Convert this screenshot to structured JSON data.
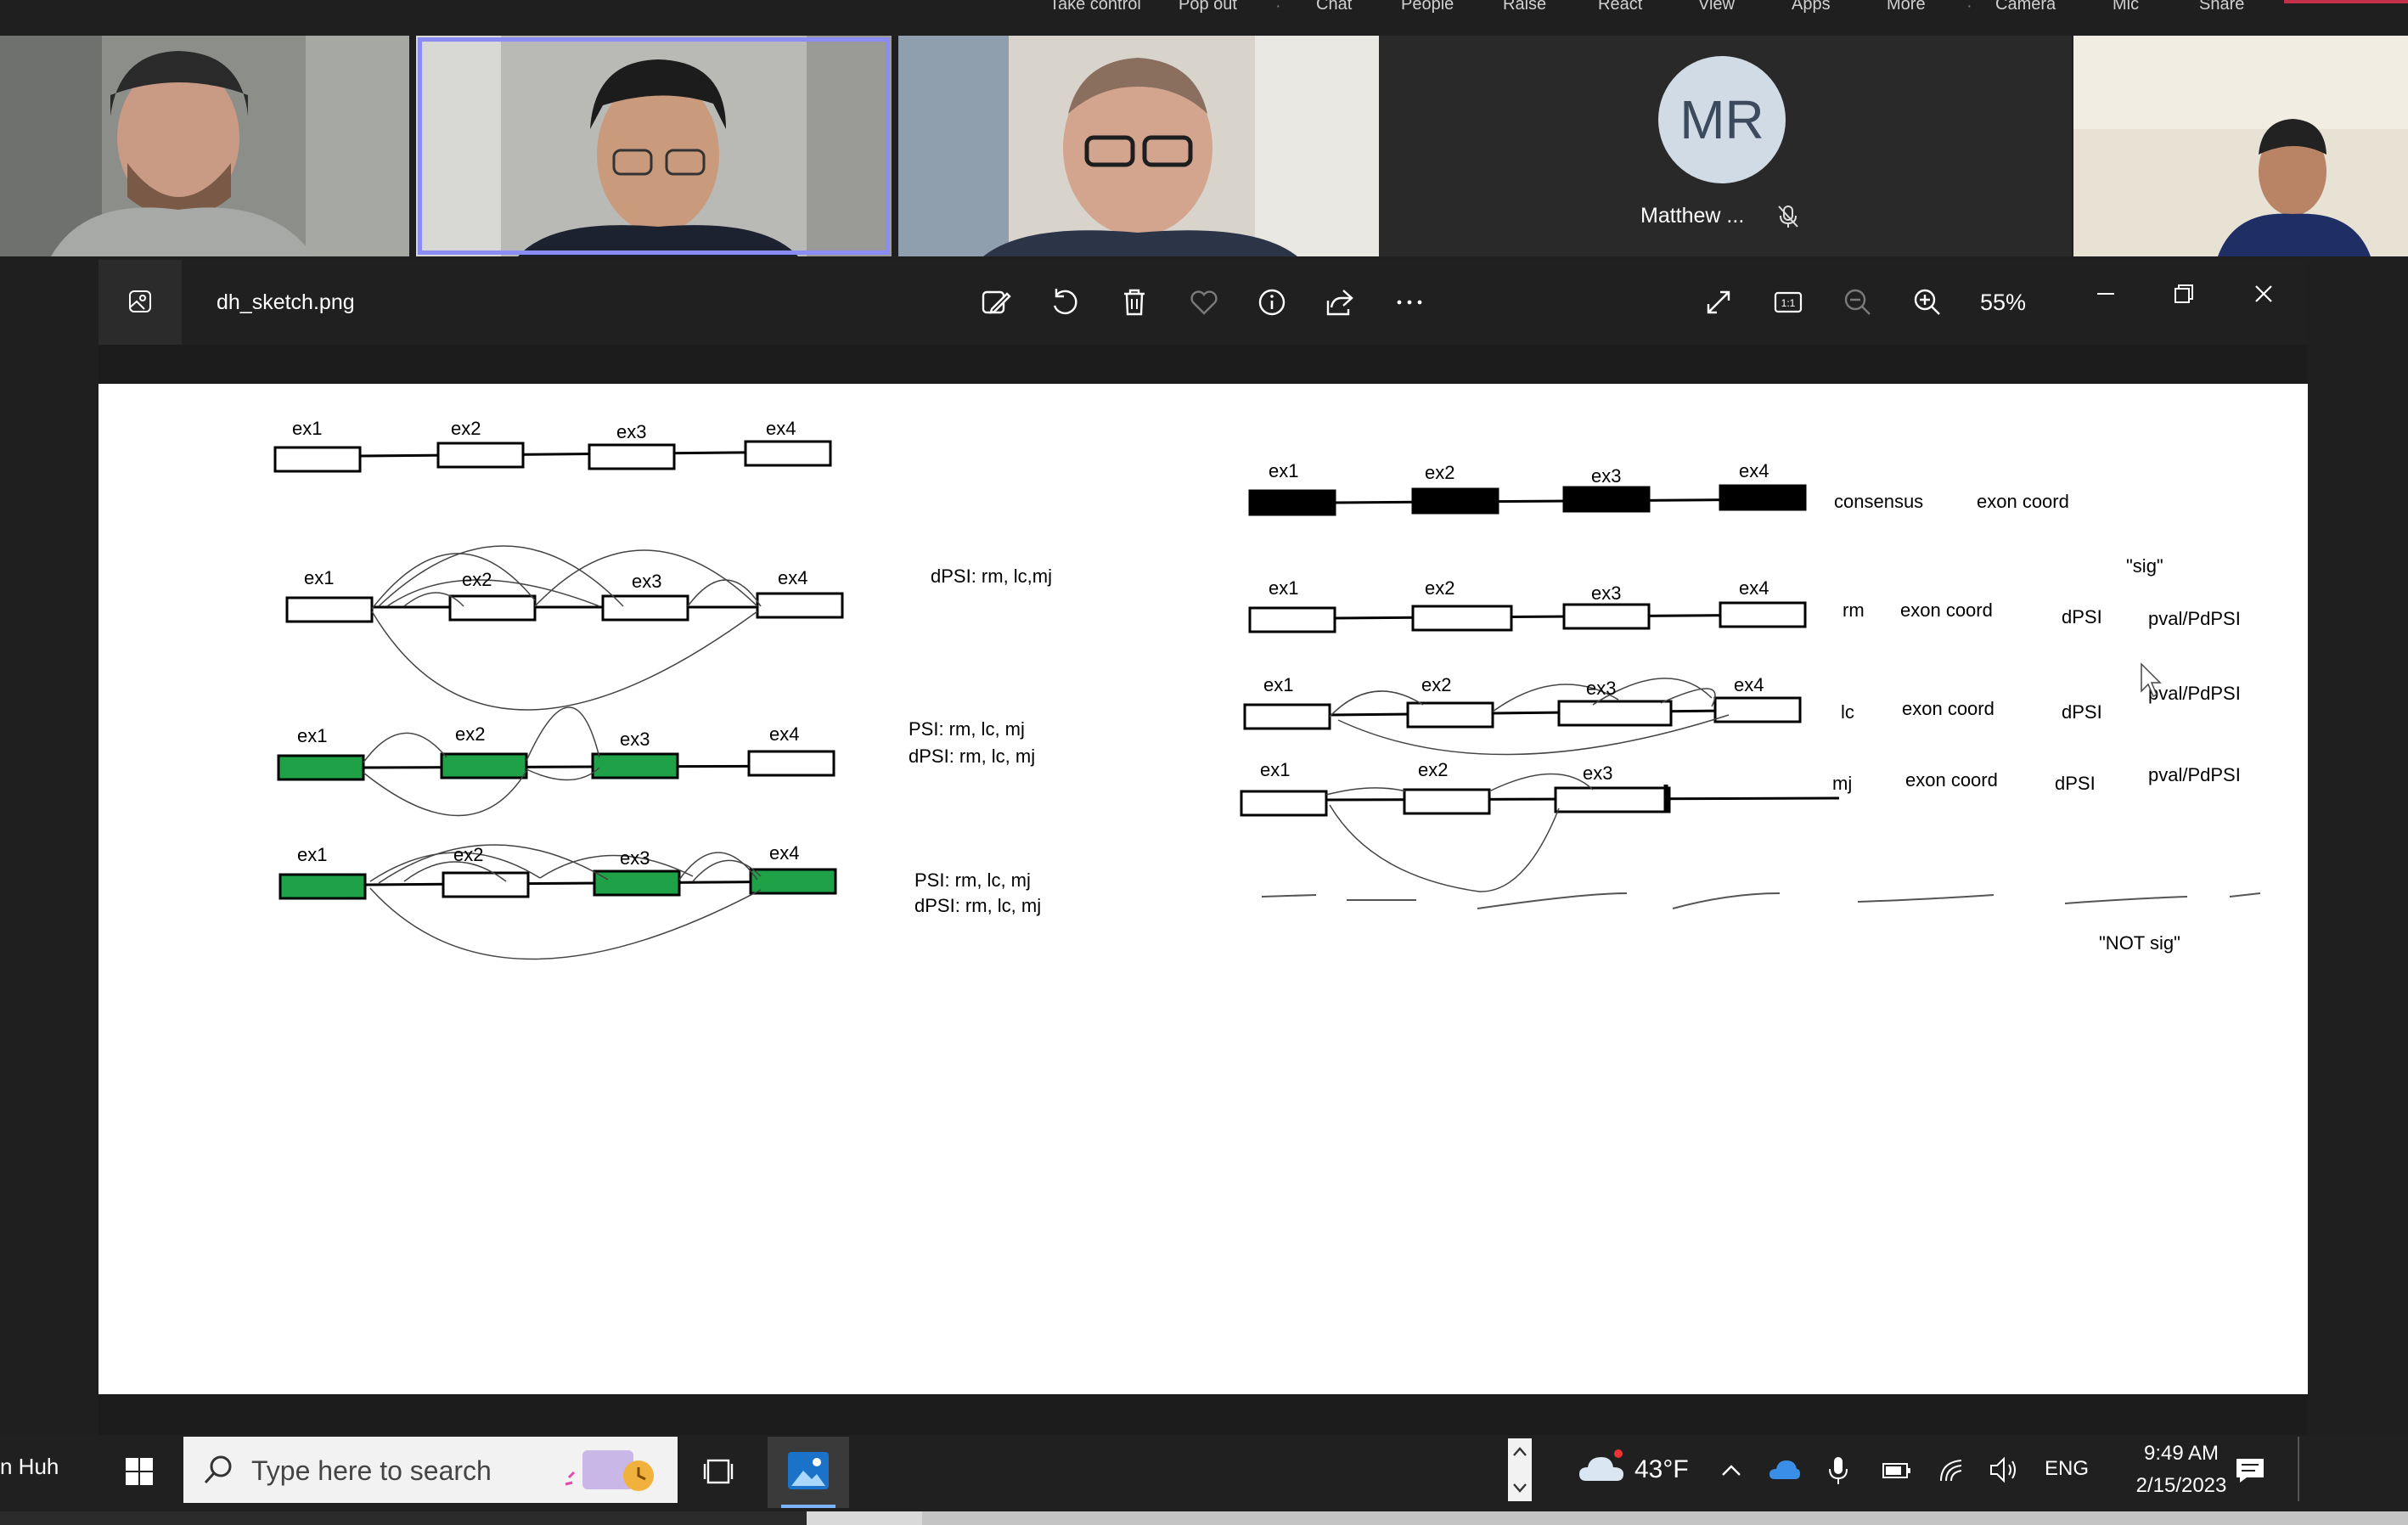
{
  "teams_toolbar": {
    "items": [
      "Take control",
      "Pop out",
      "Chat",
      "People",
      "Raise",
      "React",
      "View",
      "Apps",
      "More",
      "Camera",
      "Mic",
      "Share"
    ]
  },
  "participants": {
    "tile4_initials": "MR",
    "tile4_name": "Matthew ...",
    "tile4_mic_icon": "mic-off-icon"
  },
  "photos_app": {
    "file_name": "dh_sketch.png",
    "zoom_level": "55%",
    "toolbar_icons": [
      "edit-image-icon",
      "rotate-icon",
      "delete-icon",
      "favorite-icon",
      "info-icon",
      "share-icon",
      "more-icon",
      "fullscreen-icon",
      "actual-size-icon",
      "zoom-out-icon",
      "zoom-in-icon",
      "minimize-icon",
      "restore-icon",
      "close-icon"
    ]
  },
  "sketch": {
    "exon_labels": [
      "ex1",
      "ex2",
      "ex3",
      "ex4"
    ],
    "left_notes": {
      "row2": "dPSI: rm, lc,mj",
      "row3_psi": "PSI: rm, lc, mj",
      "row3_dpsi": "dPSI: rm, lc, mj",
      "row4_psi": "PSI: rm, lc, mj",
      "row4_dpsi": "dPSI: rm, lc, mj"
    },
    "right_notes": {
      "consensus": "consensus",
      "exon_coord": "exon coord",
      "sig": "\"sig\"",
      "rm": "rm",
      "lc": "lc",
      "mj": "mj",
      "dpsi": "dPSI",
      "pval": "pval/PdPSI",
      "not_sig": "\"NOT sig\""
    },
    "colors": {
      "green": "#1ea147",
      "black": "#000000"
    }
  },
  "taskbar": {
    "user_name": "n Huh",
    "search_placeholder": "Type here to search",
    "weather_temp": "43°F",
    "language": "ENG",
    "time": "9:49 AM",
    "date": "2/15/2023"
  }
}
